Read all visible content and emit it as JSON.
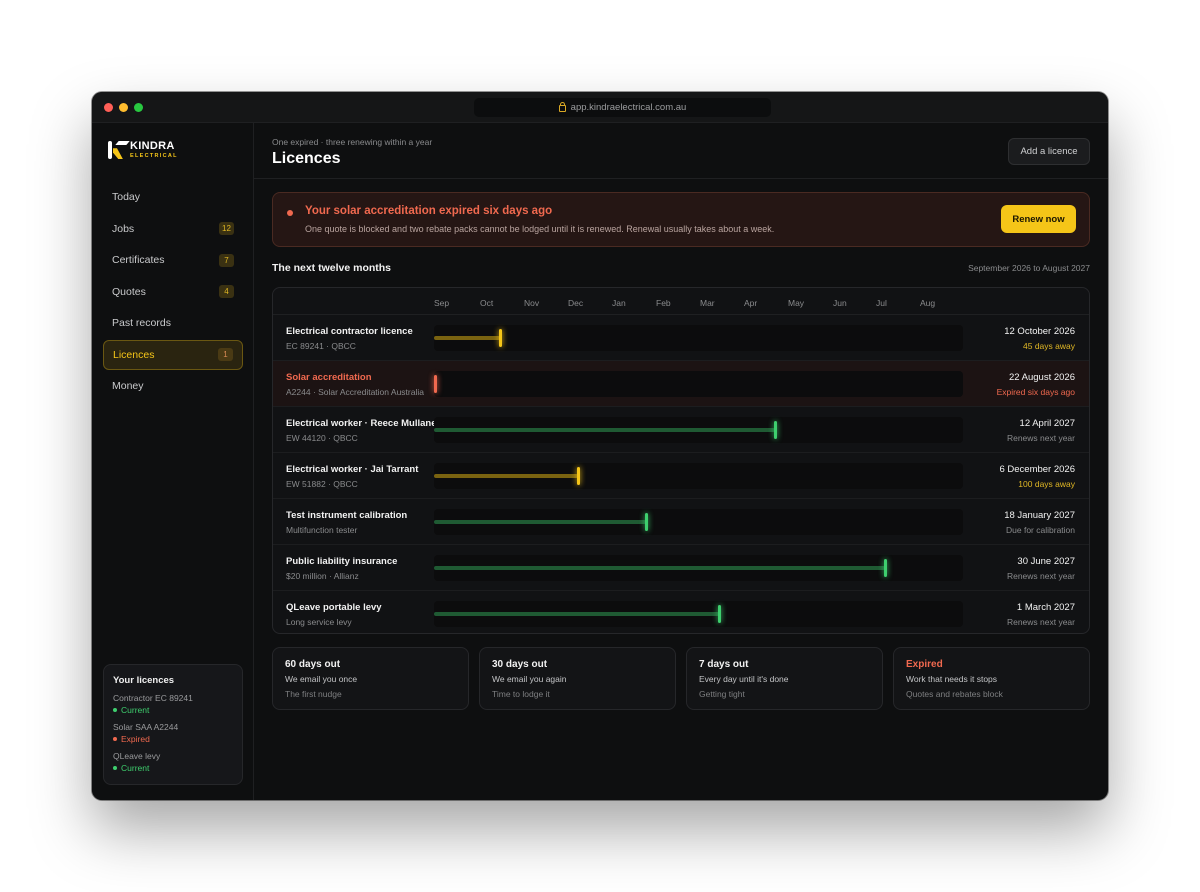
{
  "browser": {
    "url": "app.kindraelectrical.com.au"
  },
  "brand": {
    "name": "KINDRA",
    "sub": "ELECTRICAL",
    "accent": "#f5c518"
  },
  "sidebar": {
    "items": [
      {
        "label": "Today",
        "badge": ""
      },
      {
        "label": "Jobs",
        "badge": "12"
      },
      {
        "label": "Certificates",
        "badge": "7"
      },
      {
        "label": "Quotes",
        "badge": "4"
      },
      {
        "label": "Past records",
        "badge": ""
      },
      {
        "label": "Licences",
        "badge": "1",
        "active": true
      },
      {
        "label": "Money",
        "badge": ""
      }
    ],
    "card": {
      "title": "Your licences",
      "licences": [
        {
          "name": "Contractor EC 89241",
          "status": "Current",
          "color": "#3ecf6e"
        },
        {
          "name": "Solar SAA A2244",
          "status": "Expired",
          "color": "#f0694f"
        },
        {
          "name": "QLeave levy",
          "status": "Current",
          "color": "#3ecf6e"
        }
      ]
    }
  },
  "header": {
    "subtitle": "One expired · three renewing within a year",
    "title": "Licences",
    "add_button": "Add a licence"
  },
  "alert": {
    "title": "Your solar accreditation expired six days ago",
    "body": "One quote is blocked and two rebate packs cannot be lodged until it is renewed. Renewal usually takes about a week.",
    "button": "Renew now"
  },
  "timeline": {
    "title": "The next twelve months",
    "range": "September 2026 to August 2027",
    "months": [
      "Sep",
      "Oct",
      "Nov",
      "Dec",
      "Jan",
      "Feb",
      "Mar",
      "Apr",
      "May",
      "Jun",
      "Jul",
      "Aug"
    ],
    "rows": [
      {
        "name": "Electrical contractor licence",
        "sub": "EC 89241 · QBCC",
        "date": "12 October 2026",
        "status": "45 days away",
        "tone": "warn",
        "progress": 0.125
      },
      {
        "name": "Solar accreditation",
        "sub": "A2244 · Solar Accreditation Australia",
        "date": "22 August 2026",
        "status": "Expired six days ago",
        "tone": "expired",
        "progress": 0.0
      },
      {
        "name": "Electrical worker · Reece Mullane",
        "sub": "EW 44120 · QBCC",
        "date": "12 April 2027",
        "status": "Renews next year",
        "tone": "ok",
        "progress": 0.645
      },
      {
        "name": "Electrical worker · Jai Tarrant",
        "sub": "EW 51882 · QBCC",
        "date": "6 December 2026",
        "status": "100 days away",
        "tone": "warn",
        "progress": 0.272
      },
      {
        "name": "Test instrument calibration",
        "sub": "Multifunction tester",
        "date": "18 January 2027",
        "status": "Due for calibration",
        "tone": "ok",
        "progress": 0.401
      },
      {
        "name": "Public liability insurance",
        "sub": "$20 million · Allianz",
        "date": "30 June 2027",
        "status": "Renews next year",
        "tone": "ok",
        "progress": 0.852
      },
      {
        "name": "QLeave portable levy",
        "sub": "Long service levy",
        "date": "1 March 2027",
        "status": "Renews next year",
        "tone": "ok",
        "progress": 0.539
      }
    ],
    "colors": {
      "ok": "#3ecf6e",
      "warn": "#f5c518",
      "expired": "#f0694f"
    }
  },
  "reminders": [
    {
      "title": "60 days out",
      "line1": "We email you once",
      "line2": "The first nudge"
    },
    {
      "title": "30 days out",
      "line1": "We email you again",
      "line2": "Time to lodge it"
    },
    {
      "title": "7 days out",
      "line1": "Every day until it's done",
      "line2": "Getting tight"
    },
    {
      "title": "Expired",
      "line1": "Work that needs it stops",
      "line2": "Quotes and rebates block",
      "expired": true
    }
  ]
}
